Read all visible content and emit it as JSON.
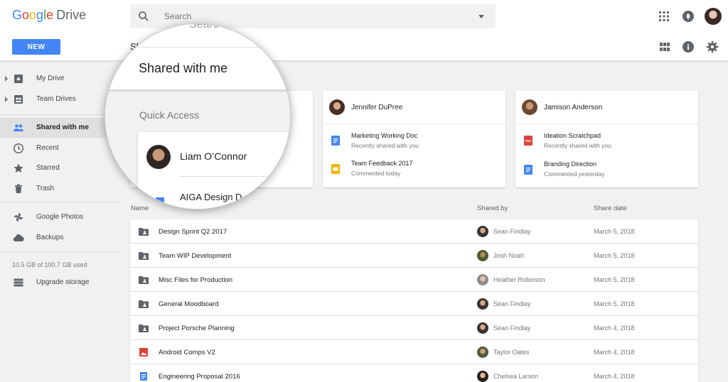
{
  "header": {
    "logo_google": [
      "G",
      "o",
      "o",
      "g",
      "l",
      "e"
    ],
    "logo_drive": "Drive",
    "search_placeholder": "Search"
  },
  "subbar": {
    "new_label": "NEW",
    "page_title_cut": "Sh"
  },
  "sidebar": {
    "items": [
      {
        "label": "My Drive",
        "icon": "my-drive-icon",
        "expandable": true,
        "active": false
      },
      {
        "label": "Team Drives",
        "icon": "team-drives-icon",
        "expandable": true,
        "active": false
      },
      {
        "label": "Shared with me",
        "icon": "people-icon",
        "expandable": false,
        "active": true
      },
      {
        "label": "Recent",
        "icon": "clock-icon",
        "expandable": false,
        "active": false
      },
      {
        "label": "Starred",
        "icon": "star-icon",
        "expandable": false,
        "active": false
      },
      {
        "label": "Trash",
        "icon": "trash-icon",
        "expandable": false,
        "active": false
      },
      {
        "label": "Google Photos",
        "icon": "photos-icon",
        "expandable": false,
        "active": false
      },
      {
        "label": "Backups",
        "icon": "cloud-icon",
        "expandable": false,
        "active": false
      }
    ],
    "storage_text": "10.5 GB of 100.7 GB used",
    "upgrade_label": "Upgrade storage"
  },
  "magnifier": {
    "search_cut": "Searc",
    "title": "Shared with me",
    "quick_access": "Quick Access",
    "person": "Liam O’Connor",
    "file_cut": "AIGA Design D"
  },
  "cards": [
    {
      "person": "Jennifer DuPree",
      "files": [
        {
          "title": "Marketing Working Doc",
          "sub": "Recently shared with you",
          "type": "doc",
          "color": "#4285f4"
        },
        {
          "title": "Team Feedback 2017",
          "sub": "Commented today",
          "type": "slides",
          "color": "#f4b400"
        }
      ]
    },
    {
      "person": "Jamison Anderson",
      "files": [
        {
          "title": "Ideation Scratchpad",
          "sub": "Recently shared with you",
          "type": "pdf",
          "color": "#db4437"
        },
        {
          "title": "Branding Direction",
          "sub": "Commented yesterday",
          "type": "doc",
          "color": "#4285f4"
        }
      ]
    }
  ],
  "table": {
    "headers": {
      "name": "Name",
      "shared_by": "Shared by",
      "share_date": "Share date"
    },
    "rows": [
      {
        "name": "Design Sprint Q2 2017",
        "type": "shared-folder",
        "shared_by": "Sean Findlay",
        "date": "March 5, 2018"
      },
      {
        "name": "Team WIP Development",
        "type": "shared-folder",
        "shared_by": "Josh Noah",
        "date": "March 5, 2018"
      },
      {
        "name": "Misc Files for Production",
        "type": "shared-folder",
        "shared_by": "Heather Robinson",
        "date": "March 5, 2018"
      },
      {
        "name": "General Moodboard",
        "type": "shared-folder",
        "shared_by": "Sean Findlay",
        "date": "March 5, 2018"
      },
      {
        "name": "Project Porsche Planning",
        "type": "shared-folder",
        "shared_by": "Sean Findlay",
        "date": "March 4, 2018"
      },
      {
        "name": "Android Comps V2",
        "type": "image",
        "shared_by": "Taylor Oates",
        "date": "March 4, 2018"
      },
      {
        "name": "Engineering Proposal 2016",
        "type": "doc",
        "shared_by": "Chelsea Larson",
        "date": "March 4, 2018"
      }
    ]
  },
  "colors": {
    "accent": "#4285f4",
    "sidebar_active": "#e0e0e0",
    "page_bg": "#f1f1f1"
  }
}
